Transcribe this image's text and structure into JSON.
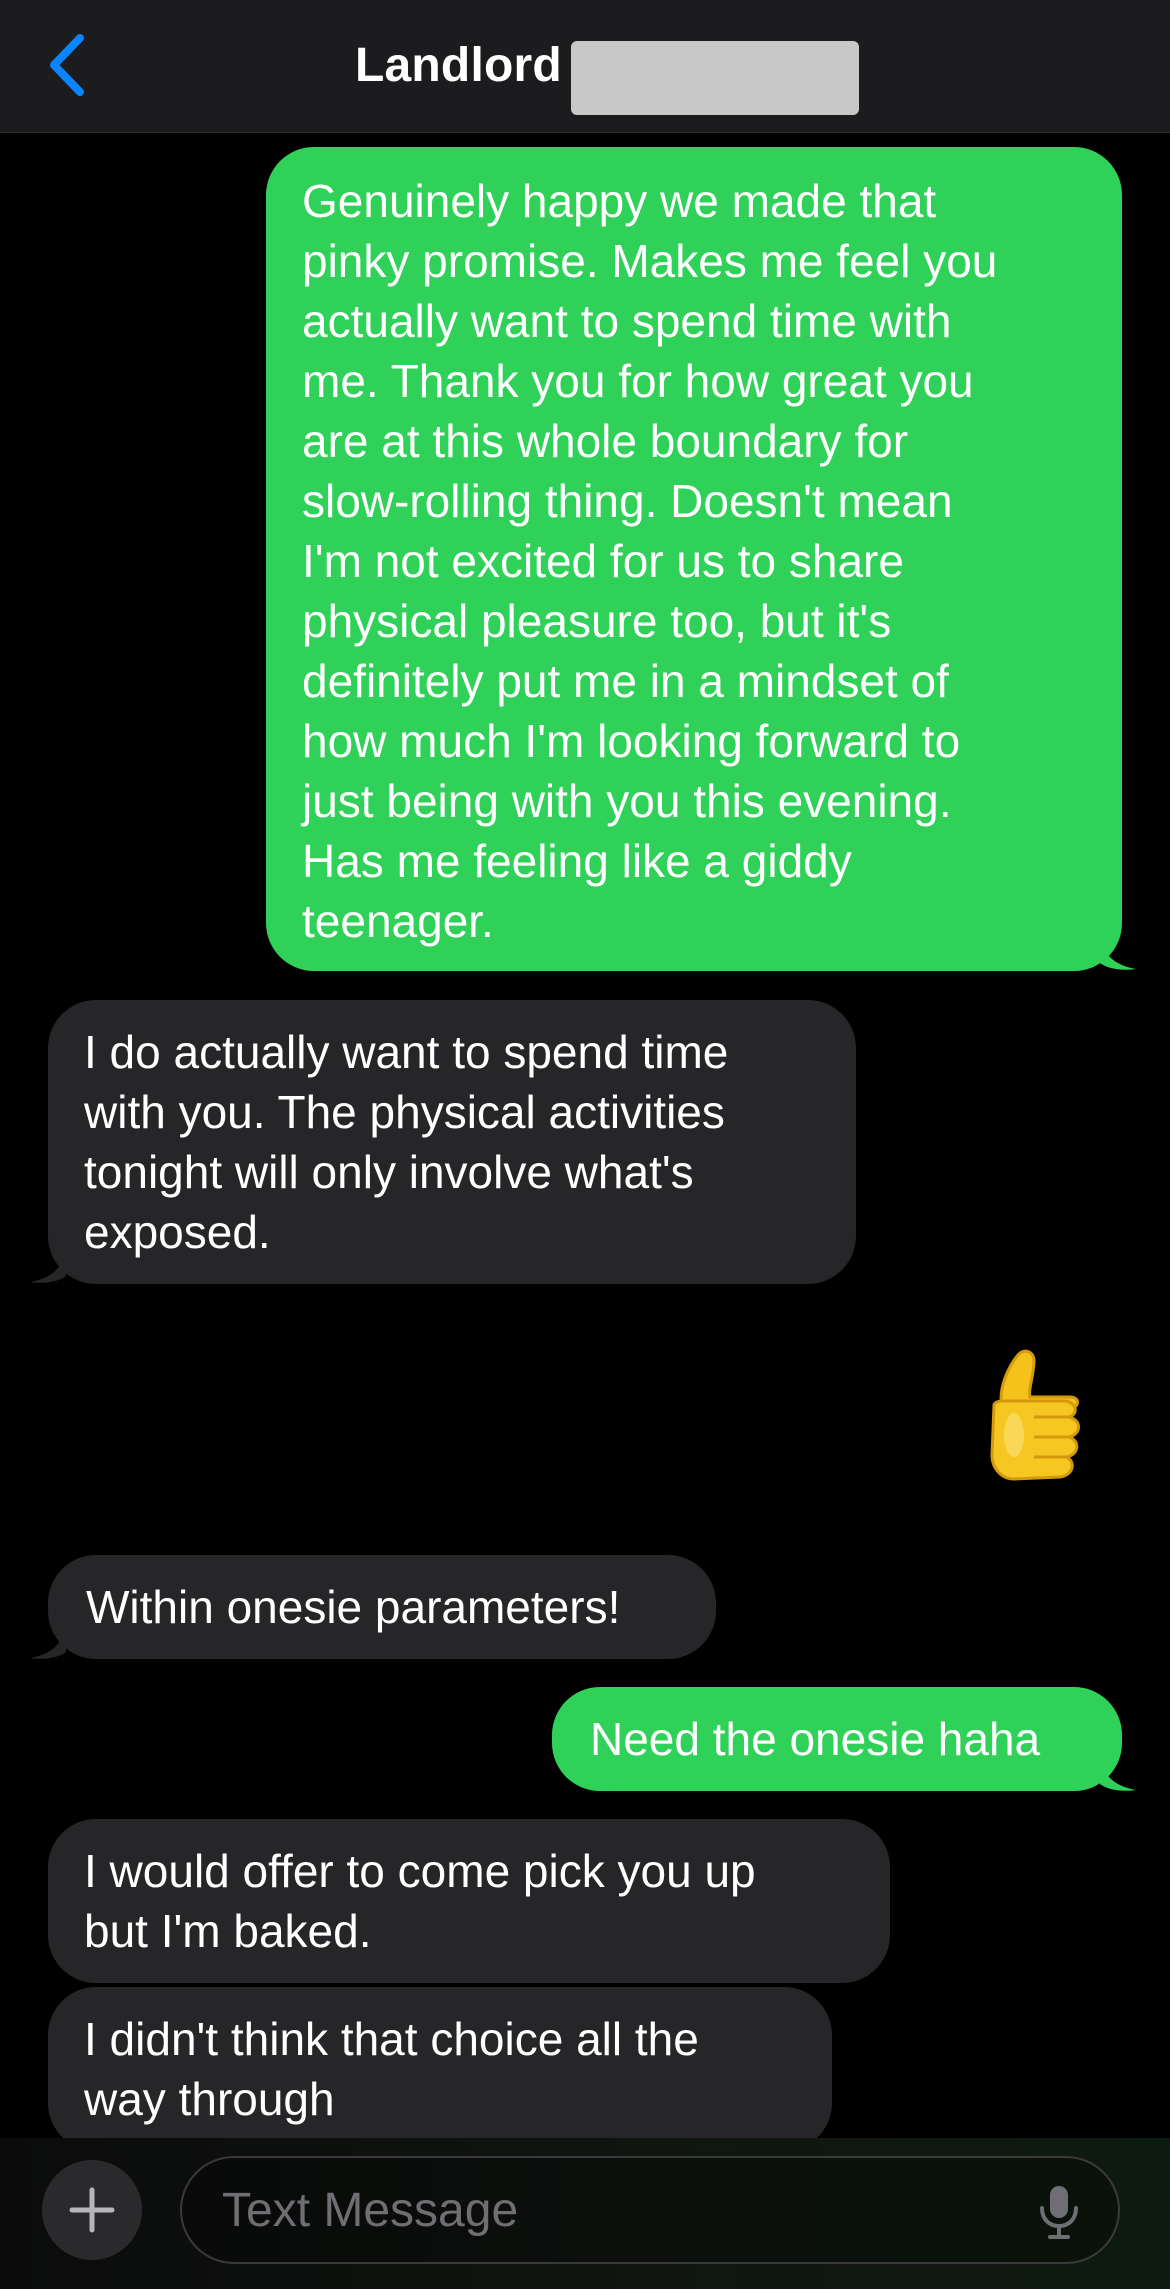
{
  "header": {
    "title": "Landlord"
  },
  "messages": [
    {
      "from": "me",
      "lines": [
        "Genuinely happy we made that",
        "pinky promise. Makes me feel you",
        "actually want to spend time with",
        "me. Thank you for how great you",
        "are at this whole boundary for",
        "slow-rolling thing. Doesn't mean",
        "I'm not excited for us to share",
        "physical pleasure too, but it's",
        "definitely put me in a mindset of",
        "how much I'm looking forward to",
        "just being with you this evening.",
        "Has me feeling like a giddy",
        "teenager."
      ]
    },
    {
      "from": "them",
      "lines": [
        "I do actually want to spend time",
        "with you. The physical activities",
        "tonight will only involve what's",
        "exposed."
      ]
    },
    {
      "from": "me",
      "emoji": "thumbs-up"
    },
    {
      "from": "them",
      "lines": [
        "Within onesie parameters!"
      ]
    },
    {
      "from": "me",
      "lines": [
        "Need the onesie haha"
      ]
    },
    {
      "from": "them",
      "lines": [
        "I would offer to come pick you up",
        "but I'm baked."
      ]
    },
    {
      "from": "them",
      "lines": [
        "I didn't think that choice all the",
        "way through"
      ]
    }
  ],
  "composer": {
    "placeholder": "Text Message"
  },
  "colors": {
    "sent_bubble": "#30d158",
    "received_bubble": "#262629",
    "accent": "#0a84ff"
  },
  "icons": {
    "back": "chevron-left-icon",
    "plus": "plus-icon",
    "mic": "microphone-icon",
    "emoji": "thumbs-up-emoji"
  }
}
